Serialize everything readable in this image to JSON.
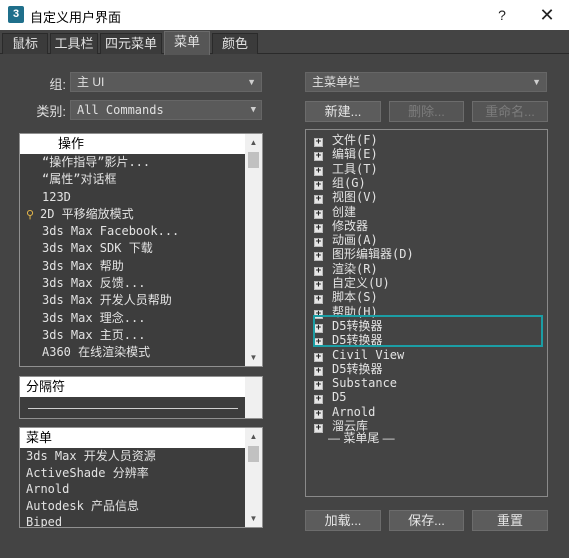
{
  "window": {
    "title": "自定义用户界面",
    "icon_label": "3",
    "help": "?",
    "close": "✕"
  },
  "tabs": [
    "鼠标",
    "工具栏",
    "四元菜单",
    "菜单",
    "颜色"
  ],
  "left": {
    "group_label": "组:",
    "group_value": "主 UI",
    "category_label": "类别:",
    "category_value": "All Commands",
    "actions_header": "操作",
    "actions": [
      "“操作指导”影片...",
      "“属性”对话框",
      "123D",
      "2D 平移缩放模式",
      "3ds Max Facebook...",
      "3ds Max SDK 下载",
      "3ds Max 帮助",
      "3ds Max 反馈...",
      "3ds Max 开发人员帮助",
      "3ds Max 理念...",
      "3ds Max 主页...",
      "A360 在线渲染模式"
    ],
    "separator_header": "分隔符",
    "menus_header": "菜单",
    "menus": [
      "3ds Max 开发人员资源",
      "ActiveShade 分辨率",
      "Arnold",
      "Autodesk 产品信息",
      "Biped"
    ]
  },
  "right": {
    "menu_combo": "主菜单栏",
    "new_btn": "新建...",
    "delete_btn": "删除...",
    "rename_btn": "重命名...",
    "tree": [
      "文件(F)",
      "编辑(E)",
      "工具(T)",
      "组(G)",
      "视图(V)",
      "创建",
      "修改器",
      "动画(A)",
      "图形编辑器(D)",
      "渲染(R)",
      "自定义(U)",
      "脚本(S)",
      "帮助(H)",
      "D5转换器",
      "D5转换器",
      "Civil View",
      "D5转换器",
      "Substance",
      "D5",
      "Arnold",
      "溜云库"
    ],
    "tree_end": "— 菜单尾 —",
    "load_btn": "加载...",
    "save_btn": "保存...",
    "reset_btn": "重置"
  }
}
